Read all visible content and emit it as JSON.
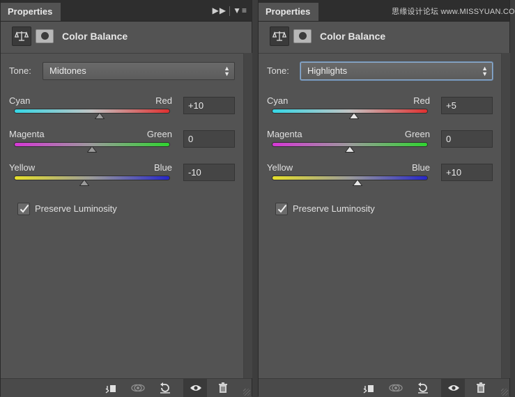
{
  "watermark": "思缘设计论坛 www.MISSYUAN.COM",
  "panels": [
    {
      "tab": "Properties",
      "title": "Color Balance",
      "tone_label": "Tone:",
      "tone_value": "Midtones",
      "sliders": [
        {
          "left": "Cyan",
          "right": "Red",
          "value": "+10",
          "position": 0.55,
          "gradient": [
            "#35d7e6",
            "#c3c3c3",
            "#e03030"
          ]
        },
        {
          "left": "Magenta",
          "right": "Green",
          "value": "0",
          "position": 0.5,
          "gradient": [
            "#d637d6",
            "#9a9a9a",
            "#2fd42f"
          ]
        },
        {
          "left": "Yellow",
          "right": "Blue",
          "value": "-10",
          "position": 0.45,
          "gradient": [
            "#e6e02a",
            "#9a9a9a",
            "#2626c8"
          ]
        }
      ],
      "preserve_label": "Preserve Luminosity",
      "preserve_checked": true
    },
    {
      "tab": "Properties",
      "title": "Color Balance",
      "tone_label": "Tone:",
      "tone_value": "Highlights",
      "sliders": [
        {
          "left": "Cyan",
          "right": "Red",
          "value": "+5",
          "position": 0.525,
          "gradient": [
            "#35d7e6",
            "#c3c3c3",
            "#e03030"
          ]
        },
        {
          "left": "Magenta",
          "right": "Green",
          "value": "0",
          "position": 0.5,
          "gradient": [
            "#d637d6",
            "#9a9a9a",
            "#2fd42f"
          ]
        },
        {
          "left": "Yellow",
          "right": "Blue",
          "value": "+10",
          "position": 0.55,
          "gradient": [
            "#e6e02a",
            "#9a9a9a",
            "#2626c8"
          ]
        }
      ],
      "preserve_label": "Preserve Luminosity",
      "preserve_checked": true
    }
  ],
  "footer_icons": [
    "clip-to-layer-icon",
    "view-previous-state-icon",
    "reset-icon",
    "visibility-eye-icon",
    "trash-icon"
  ]
}
